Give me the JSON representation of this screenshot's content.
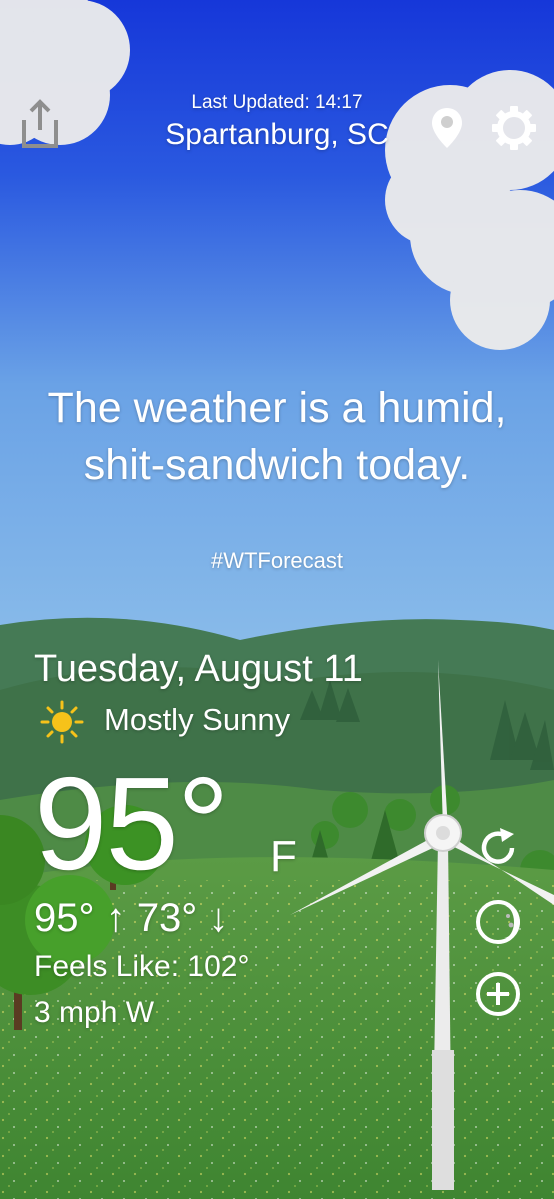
{
  "header": {
    "last_updated": "Last Updated: 14:17",
    "location": "Spartanburg, SC"
  },
  "forecast": {
    "headline": "The weather is a humid, shit-sandwich today.",
    "hashtag": "#WTForecast"
  },
  "current": {
    "date": "Tuesday, August 11",
    "condition": "Mostly Sunny",
    "condition_icon": "sun-icon",
    "temperature": "95°",
    "unit": "F",
    "high_low": "95° ↑  73° ↓",
    "feels_like": "Feels Like: 102°",
    "wind": "3 mph W"
  },
  "icons": {
    "share": "share-icon",
    "location": "location-pin-icon",
    "settings": "gear-icon",
    "refresh": "refresh-icon",
    "moon": "moon-icon",
    "add": "add-icon"
  },
  "colors": {
    "sky_top": "#1a43d6",
    "sky_bottom": "#7fb3e6",
    "grass": "#4c8f3a",
    "sun": "#f6c21a"
  }
}
